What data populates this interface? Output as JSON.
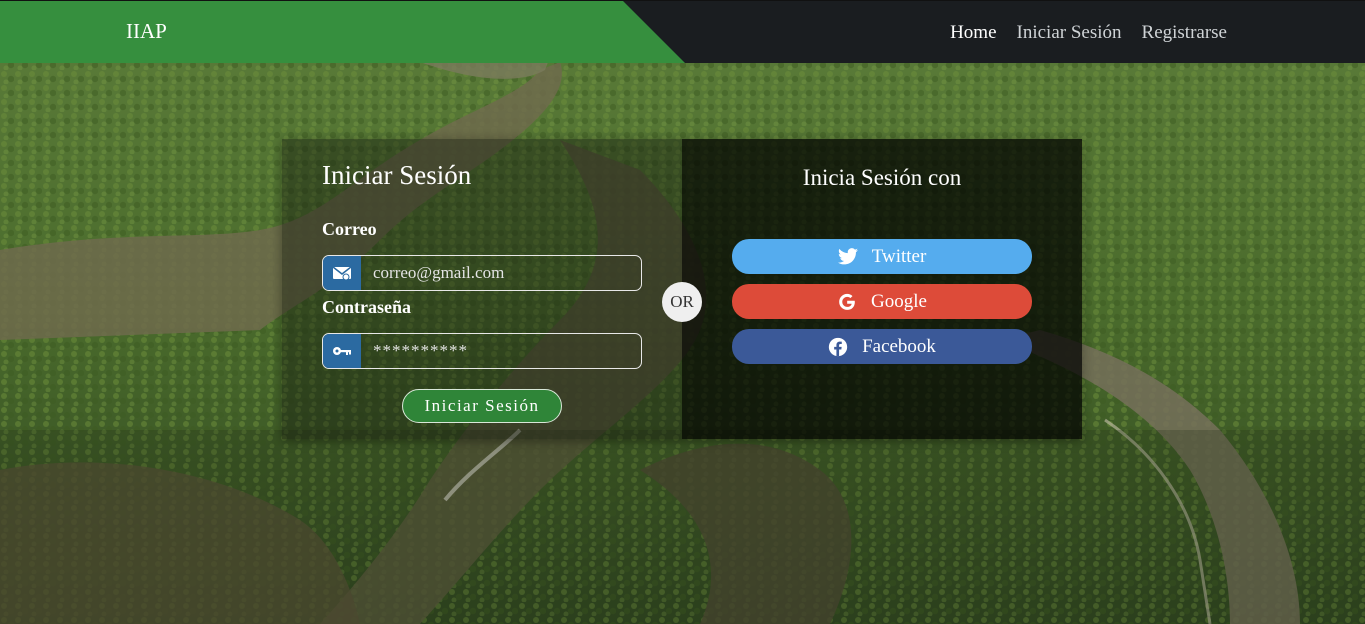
{
  "navbar": {
    "brand": "IIAP",
    "links": [
      "Home",
      "Iniciar Sesión",
      "Registrarse"
    ],
    "active": "Home"
  },
  "login": {
    "title": "Iniciar Sesión",
    "email_label": "Correo",
    "email_placeholder": "correo@gmail.com",
    "password_label": "Contraseña",
    "password_placeholder": "**********",
    "submit_label": "Iniciar Sesión"
  },
  "divider": {
    "label": "OR"
  },
  "social": {
    "title": "Inicia Sesión con",
    "buttons": [
      {
        "label": "Twitter",
        "icon": "twitter-icon",
        "color": "#55acee"
      },
      {
        "label": "Google",
        "icon": "google-icon",
        "color": "#dd4b39"
      },
      {
        "label": "Facebook",
        "icon": "facebook-icon",
        "color": "#3b5998"
      }
    ]
  },
  "colors": {
    "nav_green": "#368f3e",
    "nav_dark": "#1a1d20",
    "input_icon_bg": "#2b6aa1",
    "submit_bg": "#2f8538"
  }
}
